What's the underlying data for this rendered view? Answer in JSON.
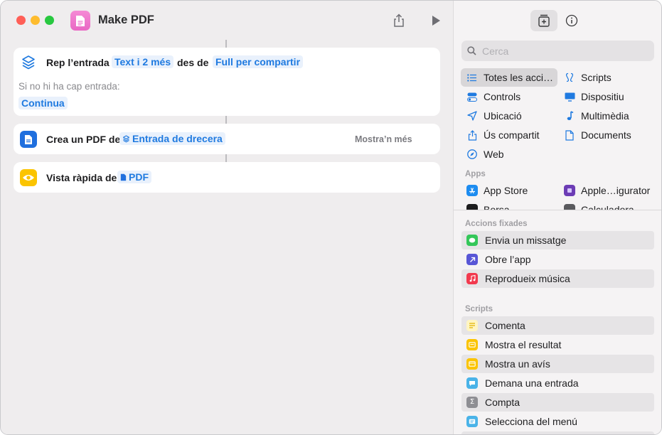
{
  "window": {
    "title": "Make PDF"
  },
  "actions": [
    {
      "label": "Rep l’entrada",
      "token1": "Text i 2 més",
      "middle": "des de",
      "token2": "Full per compartir",
      "sub_label": "Si no hi ha cap entrada:",
      "sub_token": "Continua"
    },
    {
      "label": "Crea un PDF de",
      "token": "Entrada de drecera",
      "more": "Mostra’n més"
    },
    {
      "label": "Vista ràpida de",
      "token": "PDF"
    }
  ],
  "sidebar": {
    "search_placeholder": "Cerca",
    "categories_left": [
      "Totes les acci…",
      "Controls",
      "Ubicació",
      "Ús compartit",
      "Web"
    ],
    "categories_right": [
      "Scripts",
      "Dispositiu",
      "Multimèdia",
      "Documents"
    ],
    "apps_header": "Apps",
    "apps": [
      "App Store",
      "Apple…igurator",
      "Borsa",
      "Calculadora"
    ],
    "pinned_header": "Accions fixades",
    "pinned": [
      "Envia un missatge",
      "Obre l’app",
      "Reprodueix música"
    ],
    "scripts_header": "Scripts",
    "scripts": [
      "Comenta",
      "Mostra el resultat",
      "Mostra un avís",
      "Demana una entrada",
      "Compta",
      "Selecciona del menú"
    ]
  },
  "colors": {
    "accent": "#1f7ae0",
    "token_bg": "#e9f1fc",
    "app_icon": "#ef75cc",
    "preview_icon": "#fbc400",
    "pdf_icon": "#1f6fde"
  }
}
